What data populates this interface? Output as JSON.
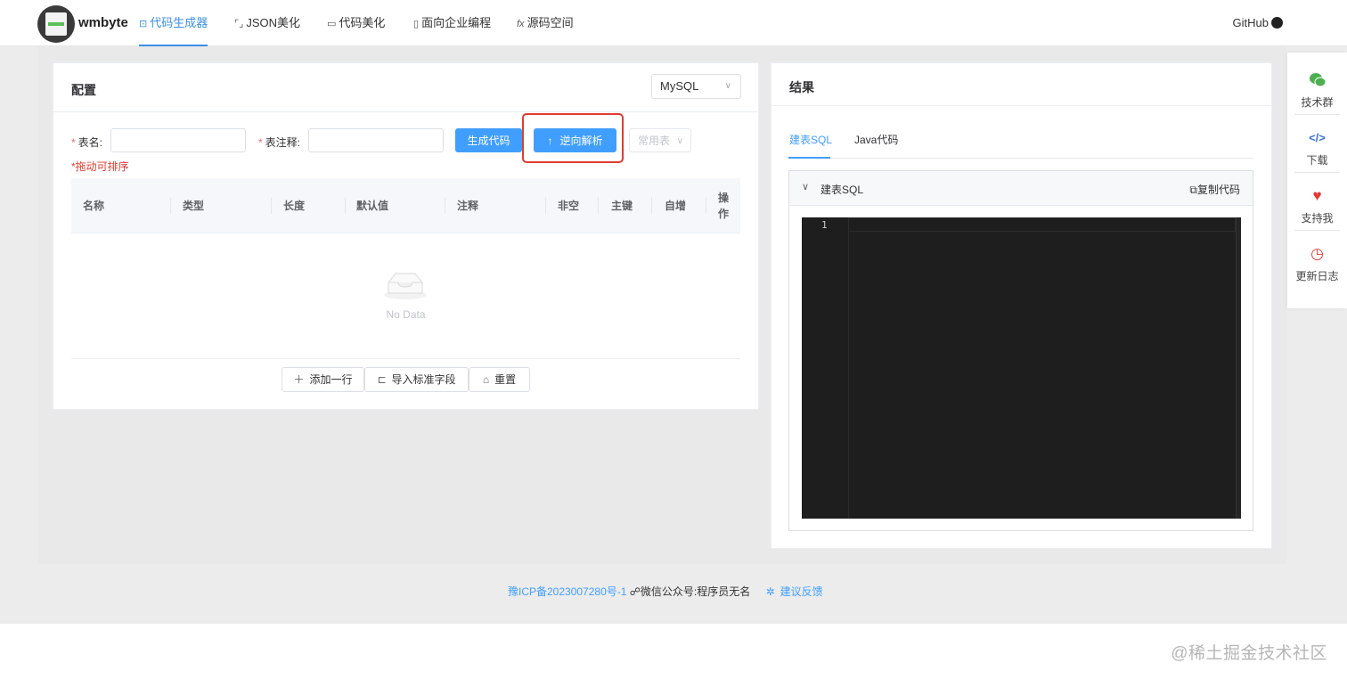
{
  "header": {
    "brand": "wmbyte",
    "nav": [
      {
        "icon": "terminal-icon",
        "label": "代码生成器",
        "active": true
      },
      {
        "icon": "brackets-icon",
        "label": "JSON美化"
      },
      {
        "icon": "monitor-icon",
        "label": "代码美化"
      },
      {
        "icon": "document-icon",
        "label": "面向企业编程"
      },
      {
        "icon": "function-icon",
        "label": "源码空间"
      }
    ],
    "github": "GitHub"
  },
  "config": {
    "title": "配置",
    "db_select": "MySQL",
    "table_name_label": "表名:",
    "table_name_value": "",
    "table_comment_label": "表注释:",
    "table_comment_value": "",
    "generate_btn": "生成代码",
    "reverse_btn": "逆向解析",
    "common_table": "常用表",
    "drag_hint": "*拖动可排序",
    "columns": [
      "名称",
      "类型",
      "长度",
      "默认值",
      "注释",
      "非空",
      "主键",
      "自增",
      "操作"
    ],
    "empty_text": "No Data",
    "add_row": "添加一行",
    "import_fields": "导入标准字段",
    "reset": "重置"
  },
  "result": {
    "title": "结果",
    "tabs": [
      "建表SQL",
      "Java代码"
    ],
    "active_tab": "建表SQL",
    "panel_title": "建表SQL",
    "copy": "复制代码",
    "line_number": "1"
  },
  "sidebar": [
    {
      "icon": "wechat-icon",
      "label": "技术群",
      "color": "#4caf50"
    },
    {
      "icon": "code-icon",
      "label": "下载",
      "color": "#3a6fd8"
    },
    {
      "icon": "heart-icon",
      "label": "支持我",
      "color": "#e53935"
    },
    {
      "icon": "history-icon",
      "label": "更新日志",
      "color": "#e53935"
    }
  ],
  "footer": {
    "icp": "豫ICP备2023007280号-1",
    "wechat": "微信公众号:程序员无名",
    "feedback": "建议反馈"
  },
  "watermark": "@稀土掘金技术社区",
  "colors": {
    "primary": "#409eff",
    "highlight": "#e03c31"
  }
}
